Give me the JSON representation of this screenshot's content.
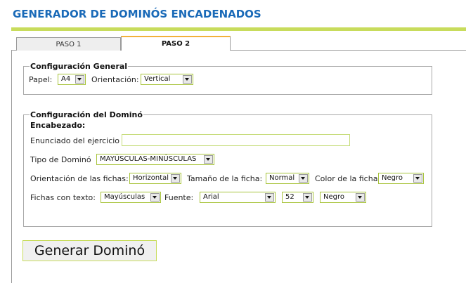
{
  "header": {
    "title": "GENERADOR DE DOMINÓS ENCADENADOS"
  },
  "tabs": [
    {
      "label": "PASO 1"
    },
    {
      "label": "PASO 2"
    }
  ],
  "general": {
    "legend": "Configuración General",
    "paper_label": "Papel:",
    "paper_value": "A4",
    "orientation_label": "Orientación:",
    "orientation_value": "Vertical"
  },
  "domino": {
    "legend": "Configuración del Dominó",
    "header_label": "Encabezado:",
    "statement_label": "Enunciado del ejercicio",
    "statement_value": "",
    "type_label": "Tipo de Dominó",
    "type_value": "MAYÚSCULAS-MINÚSCULAS",
    "tile_orientation_label": "Orientación de las fichas:",
    "tile_orientation_value": "Horizontal",
    "tile_size_label": "Tamaño de la ficha:",
    "tile_size_value": "Normal",
    "tile_color_label": "Color de la ficha",
    "tile_color_value": "Negro",
    "text_tiles_label": "Fichas con texto:",
    "text_tiles_value": "Mayúsculas",
    "font_label": "Fuente:",
    "font_value": "Arial",
    "font_size_value": "52",
    "font_color_value": "Negro"
  },
  "actions": {
    "generate_label": "Generar Dominó"
  },
  "colors": {
    "title": "#1a6ab8",
    "accent": "#c8dc5c",
    "active_tab": "#f2b13a"
  }
}
